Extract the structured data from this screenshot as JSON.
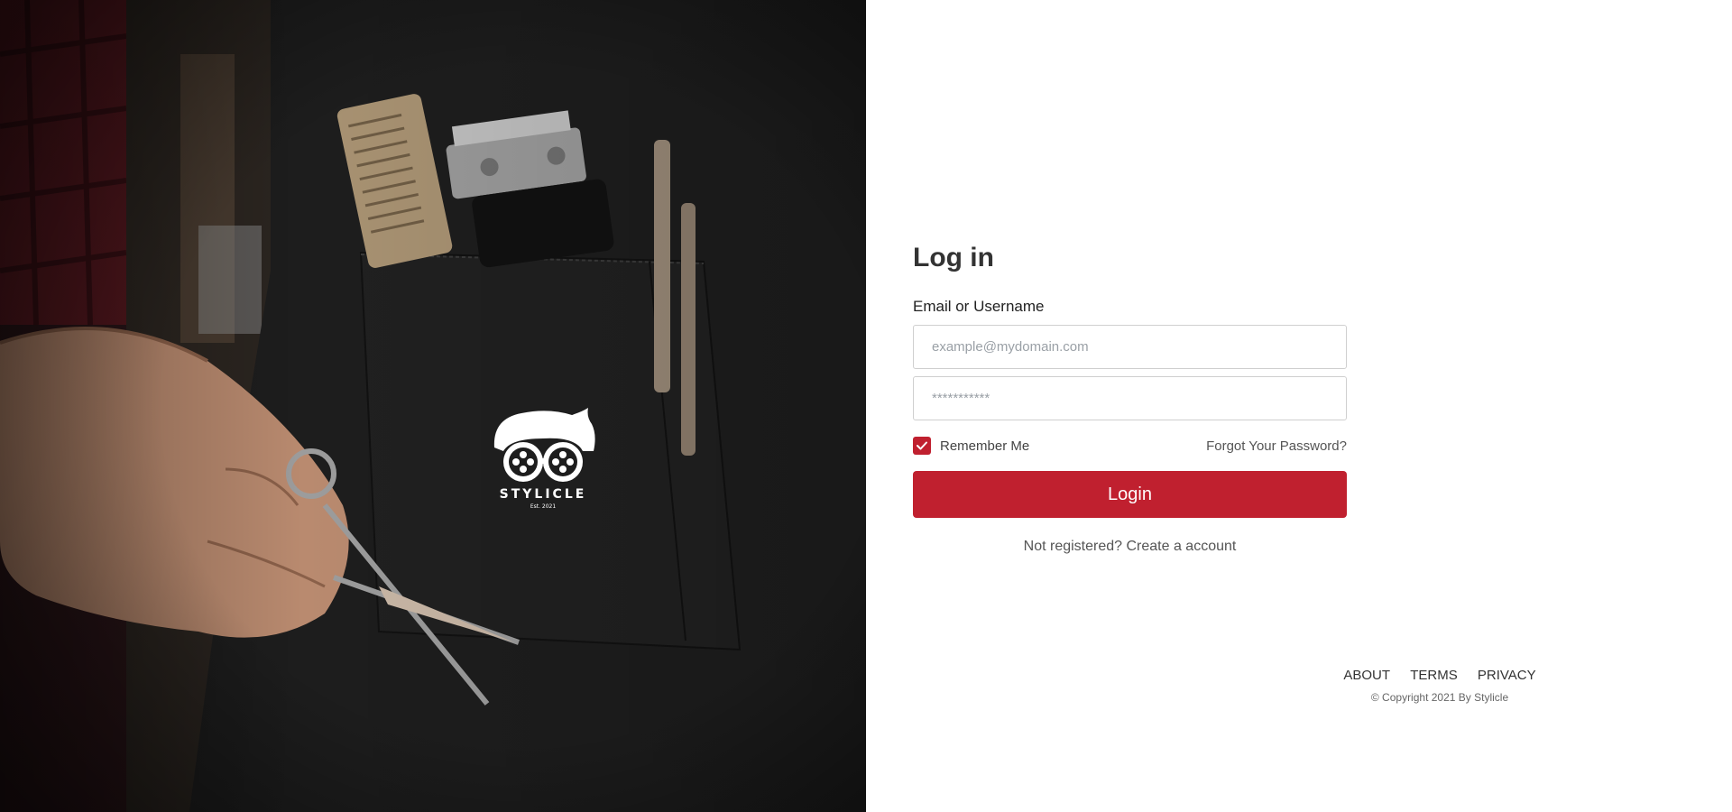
{
  "brand": {
    "name": "STYLICLE",
    "established": "Est. 2021"
  },
  "login": {
    "title": "Log in",
    "email_label": "Email or Username",
    "email_placeholder": "example@mydomain.com",
    "password_placeholder": "***********",
    "remember_label": "Remember Me",
    "remember_checked": true,
    "forgot_label": "Forgot Your Password?",
    "login_button": "Login",
    "register_text": "Not registered? Create a account"
  },
  "footer": {
    "links": [
      "ABOUT",
      "TERMS",
      "PRIVACY"
    ],
    "copyright": "© Copyright 2021 By Stylicle"
  },
  "colors": {
    "accent": "#c0202f",
    "hero_dark": "#1a1a1a",
    "text": "#333333"
  },
  "icons": {
    "checkbox": "check-icon",
    "logo": "stylicle-logo-icon"
  }
}
